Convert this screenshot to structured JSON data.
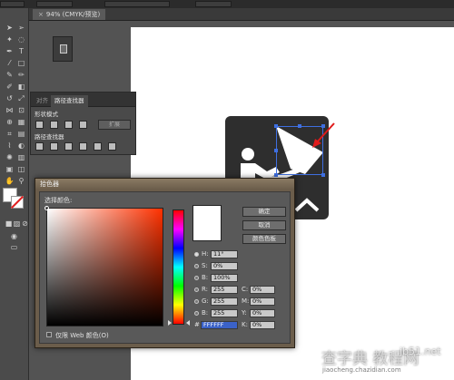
{
  "document_tab": {
    "close": "×",
    "title": "94% (CMYK/预览)"
  },
  "pathfinder_panel": {
    "tabs": [
      "对齐",
      "路径查找器"
    ],
    "shape_modes_label": "形状模式",
    "pathfinders_label": "路径查找器",
    "expand_label": "扩展"
  },
  "color_picker": {
    "title": "拾色器",
    "select_color_label": "选择颜色:",
    "ok_label": "确定",
    "cancel_label": "取消",
    "swatches_label": "颜色色板",
    "fields": [
      {
        "label": "H:",
        "value": "11°",
        "selected": true
      },
      {
        "label": "S:",
        "value": "0%",
        "selected": false
      },
      {
        "label": "B:",
        "value": "100%",
        "selected": false
      },
      {
        "label": "R:",
        "value": "255",
        "selected": false
      },
      {
        "label": "G:",
        "value": "255",
        "selected": false
      },
      {
        "label": "B:",
        "value": "255",
        "selected": false
      }
    ],
    "cmyk_fields": [
      {
        "label": "C:",
        "value": "0%"
      },
      {
        "label": "M:",
        "value": "0%"
      },
      {
        "label": "Y:",
        "value": "0%"
      },
      {
        "label": "K:",
        "value": "0%"
      }
    ],
    "hex_label": "#",
    "hex_value": "FFFFFF",
    "web_only_label": "仅限 Web 颜色(O)"
  },
  "watermark": {
    "text_1": "查字典",
    "text_2": "教程网",
    "text_3": "jb51.net",
    "text_4": "jiaocheng.chazidian.com"
  }
}
